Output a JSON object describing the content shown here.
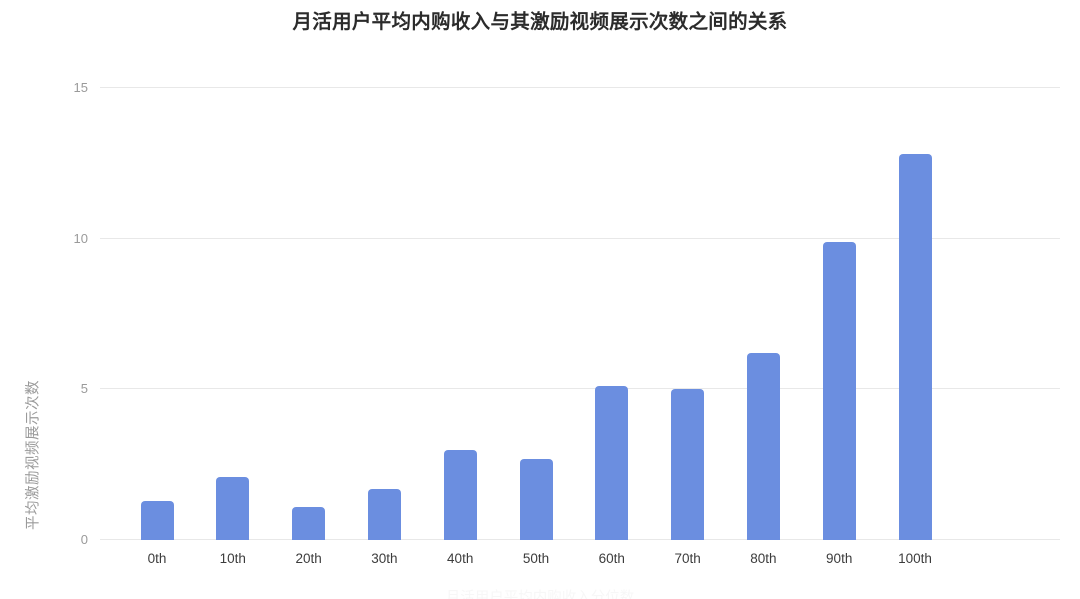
{
  "chart_data": {
    "type": "bar",
    "title": "月活用户平均内购收入与其激励视频展示次数之间的关系",
    "xlabel": "月活用户平均内购收入分位数",
    "ylabel": "平均激励视频展示次数",
    "categories": [
      "0th",
      "10th",
      "20th",
      "30th",
      "40th",
      "50th",
      "60th",
      "70th",
      "80th",
      "90th",
      "100th"
    ],
    "values": [
      1.3,
      2.1,
      1.1,
      1.7,
      3.0,
      2.7,
      5.1,
      5.0,
      6.2,
      9.9,
      12.8
    ],
    "series": [
      {
        "name": "平均激励视频展示次数",
        "values": [
          1.3,
          2.1,
          1.1,
          1.7,
          3.0,
          2.7,
          5.1,
          5.0,
          6.2,
          9.9,
          12.8
        ]
      }
    ],
    "ylim": [
      0,
      15
    ],
    "yticks": [
      0,
      5,
      10,
      15
    ],
    "ytick_labels": [
      "0",
      "5",
      "10",
      "15"
    ],
    "grid": true,
    "legend": false,
    "bar_color": "#6b8ee0",
    "grid_color": "#e8e8e8",
    "title_color": "#2b2b2b",
    "tick_color": "#9a9a9a",
    "xtick_color": "#3c3c3c",
    "background": "#ffffff"
  }
}
